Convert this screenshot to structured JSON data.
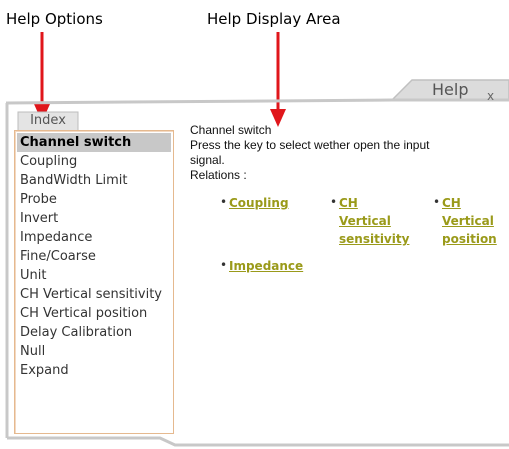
{
  "callouts": {
    "left": "Help Options",
    "right": "Help Display Area"
  },
  "window": {
    "title": "Help",
    "close": "x",
    "tab": "Index"
  },
  "index": {
    "items": [
      "Channel switch",
      "Coupling",
      "BandWidth Limit",
      "Probe",
      "Invert",
      "Impedance",
      "Fine/Coarse",
      "Unit",
      "CH Vertical sensitivity",
      "CH Vertical position",
      "Delay Calibration",
      "Null",
      "Expand"
    ],
    "selected_index": 0
  },
  "display": {
    "heading": "Channel switch",
    "line1": "Press the key to select wether open the input",
    "line2": "signal.",
    "relations_label": "Relations :",
    "links": {
      "coupling": "Coupling",
      "ch_vert_sens_1": "CH",
      "ch_vert_sens_2": "Vertical",
      "ch_vert_sens_3": "sensitivity",
      "ch_vert_pos_1": "CH",
      "ch_vert_pos_2": "Vertical",
      "ch_vert_pos_3": "position",
      "impedance": "Impedance"
    },
    "bullet": "•"
  },
  "colors": {
    "arrow": "#e0161b",
    "link": "#9a9a1a",
    "frame": "#c0c0c0",
    "list_border": "#e5b98f"
  },
  "icons": {
    "arrow_left": "arrow-down-icon",
    "arrow_right": "arrow-down-icon",
    "close": "close-icon"
  }
}
